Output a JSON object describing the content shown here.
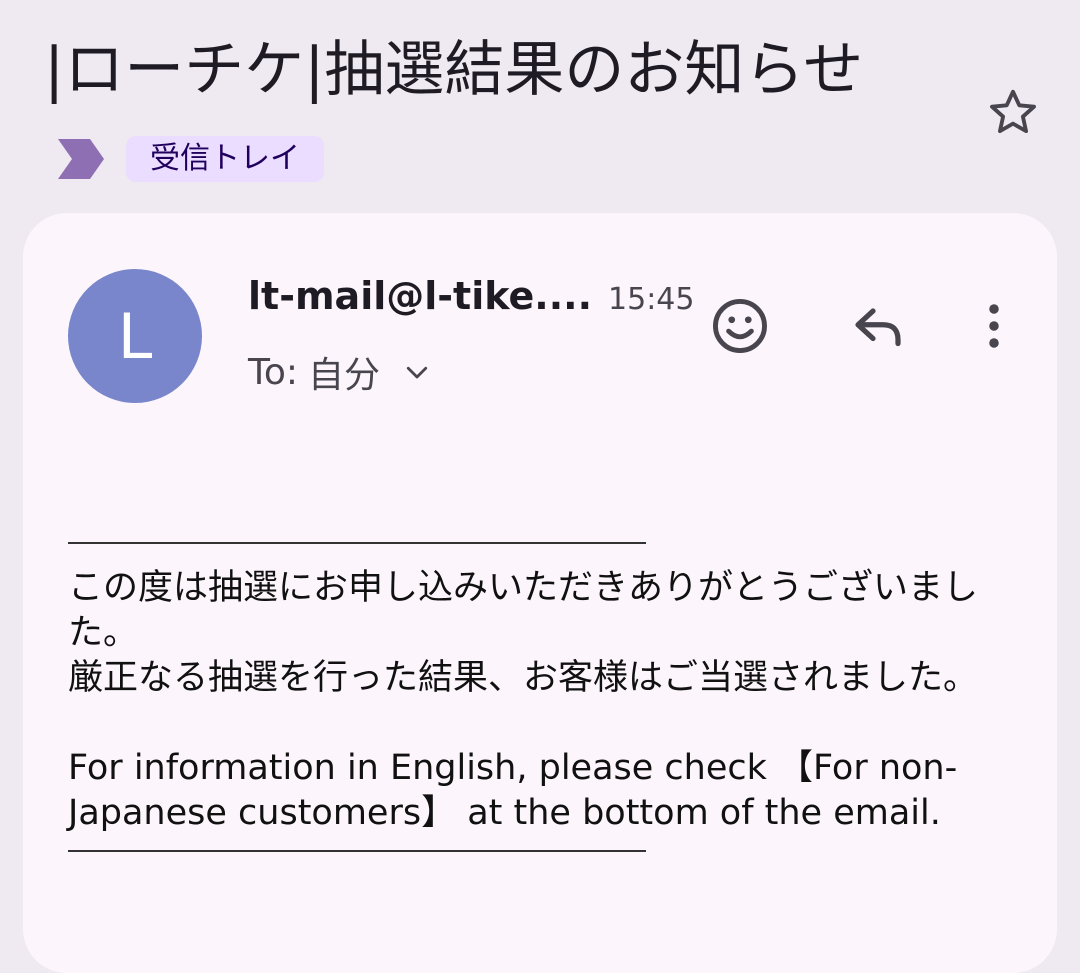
{
  "email": {
    "subject": "|ローチケ|抽選結果のお知らせ",
    "label": "受信トレイ",
    "sender_initial": "L",
    "sender": "lt-mail@l-tike....",
    "time": "15:45",
    "to_label": "To:",
    "to_value": "自分",
    "body": {
      "para1": "この度は抽選にお申し込みいただきありがとうございました。",
      "para2": "厳正なる抽選を行った結果、お客様はご当選されました。",
      "para3": "For information in English, please check 【For non-Japanese customers】 at the bottom of the email."
    }
  },
  "icons": {
    "star": "star-outline-icon",
    "label_marker": "important-marker-icon",
    "expand": "chevron-down-icon",
    "emoji": "emoji-icon",
    "reply": "reply-icon",
    "more": "more-vert-icon"
  },
  "colors": {
    "background": "#efe9f1",
    "card": "#fcf6fc",
    "avatar": "#7986cb",
    "label_chip": "#eaddff",
    "label_marker": "#8e6fb3"
  }
}
